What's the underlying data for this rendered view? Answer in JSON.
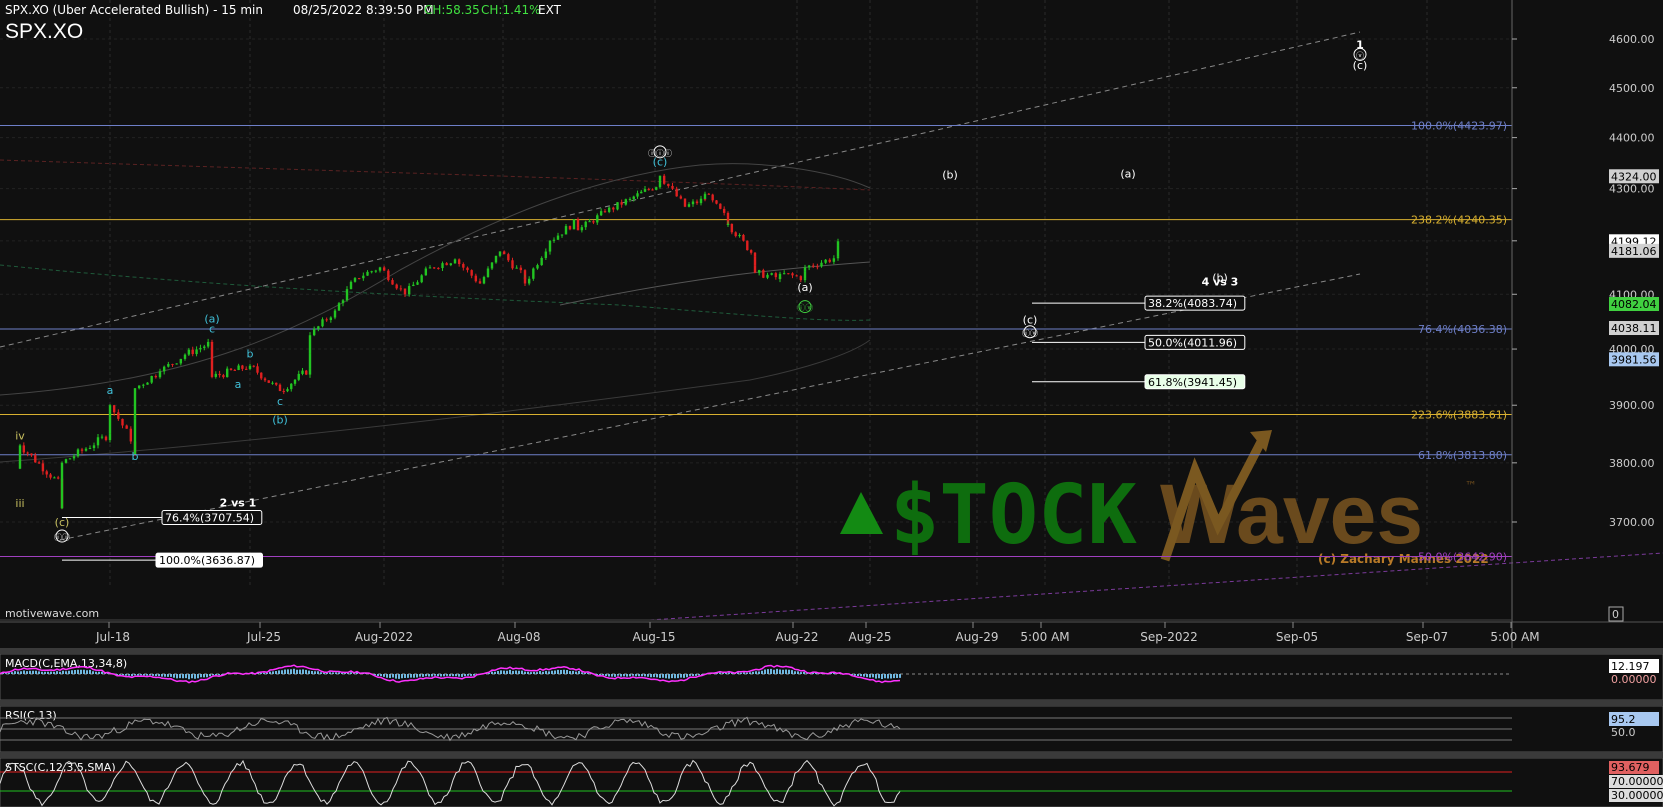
{
  "header": {
    "chart_title": "SPX.XO (Uber Accelerated Bullish) - 15 min",
    "datetime": "08/25/2022 8:39:50 PM",
    "ch_points": "CH:58.35",
    "ch_percent": "CH:1.41%",
    "session": "EXT",
    "symbol": "SPX.XO"
  },
  "credit": "motivewave.com",
  "watermark": {
    "brand_left": "$TOCK",
    "brand_right": "Waves",
    "tm": "™",
    "copyright": "(c) Zachary Mannes 2022"
  },
  "colors": {
    "background": "#101010",
    "candle_up": "#22c422",
    "candle_down": "#e02020",
    "fib_blue": "#6e7fc8",
    "fib_gold": "#d8b030",
    "wave_cyan": "#40c0d8",
    "wave_green": "#40d040",
    "wave_olive": "#c8c060",
    "macd_line": "#ff30ff",
    "macd_hist": "#70b8e0"
  },
  "chart_data": {
    "type": "candlestick",
    "title": "SPX.XO (Uber Accelerated Bullish) - 15 min",
    "timeframe": "15 min",
    "x_tick_labels": [
      "Jul-18",
      "Jul-25",
      "Aug-2022",
      "Aug-08",
      "Aug-15",
      "Aug-22",
      "Aug-25",
      "Aug-29",
      "5:00 AM",
      "Sep-2022",
      "Sep-05",
      "Sep-07",
      "5:00 AM"
    ],
    "y_tick_labels": [
      "4600.00",
      "4500.00",
      "4400.00",
      "4300.00",
      "4200.00",
      "4100.00",
      "4000.00",
      "3900.00",
      "3800.00",
      "3700.00"
    ],
    "ylim": [
      3600,
      4640
    ],
    "y_scale": "log",
    "price_path": [
      {
        "date": "Jul-14",
        "close": 3790
      },
      {
        "date": "Jul-14",
        "close": 3830
      },
      {
        "date": "Jul-15",
        "close": 3760
      },
      {
        "date": "Jul-15",
        "close": 3723
      },
      {
        "date": "Jul-15",
        "close": 3800
      },
      {
        "date": "Jul-18",
        "close": 3850
      },
      {
        "date": "Jul-18",
        "close": 3900
      },
      {
        "date": "Jul-19",
        "close": 3830
      },
      {
        "date": "Jul-19",
        "close": 3815
      },
      {
        "date": "Jul-19",
        "close": 3930
      },
      {
        "date": "Jul-20",
        "close": 3960
      },
      {
        "date": "Jul-21",
        "close": 3990
      },
      {
        "date": "Jul-22",
        "close": 4012
      },
      {
        "date": "Jul-22",
        "close": 3950
      },
      {
        "date": "Jul-25",
        "close": 3970
      },
      {
        "date": "Jul-26",
        "close": 3925
      },
      {
        "date": "Jul-27",
        "close": 3965
      },
      {
        "date": "Jul-27",
        "close": 4025
      },
      {
        "date": "Jul-28",
        "close": 4070
      },
      {
        "date": "Jul-29",
        "close": 4130
      },
      {
        "date": "Aug-01",
        "close": 4150
      },
      {
        "date": "Aug-02",
        "close": 4100
      },
      {
        "date": "Aug-03",
        "close": 4150
      },
      {
        "date": "Aug-04",
        "close": 4165
      },
      {
        "date": "Aug-05",
        "close": 4120
      },
      {
        "date": "Aug-08",
        "close": 4180
      },
      {
        "date": "Aug-09",
        "close": 4130
      },
      {
        "date": "Aug-09",
        "close": 4120
      },
      {
        "date": "Aug-10",
        "close": 4200
      },
      {
        "date": "Aug-11",
        "close": 4240
      },
      {
        "date": "Aug-11",
        "close": 4220
      },
      {
        "date": "Aug-12",
        "close": 4255
      },
      {
        "date": "Aug-15",
        "close": 4280
      },
      {
        "date": "Aug-16",
        "close": 4310
      },
      {
        "date": "Aug-16",
        "close": 4325
      },
      {
        "date": "Aug-17",
        "close": 4265
      },
      {
        "date": "Aug-18",
        "close": 4280
      },
      {
        "date": "Aug-18",
        "close": 4290
      },
      {
        "date": "Aug-19",
        "close": 4240
      },
      {
        "date": "Aug-19",
        "close": 4232
      },
      {
        "date": "Aug-22",
        "close": 4170
      },
      {
        "date": "Aug-22",
        "close": 4140
      },
      {
        "date": "Aug-23",
        "close": 4130
      },
      {
        "date": "Aug-23",
        "close": 4138
      },
      {
        "date": "Aug-24",
        "close": 4130
      },
      {
        "date": "Aug-24",
        "close": 4150
      },
      {
        "date": "Aug-25",
        "close": 4170
      },
      {
        "date": "Aug-25",
        "close": 4199.12
      }
    ],
    "fib_levels": [
      {
        "label": "100.0%(4423.97)",
        "value": 4423.97,
        "color": "#6e7fc8"
      },
      {
        "label": "238.2%(4240.35)",
        "value": 4240.35,
        "color": "#d8b030"
      },
      {
        "label": "76.4%(4036.38)",
        "value": 4036.38,
        "color": "#6e7fc8"
      },
      {
        "label": "223.6%(3883.61)",
        "value": 3883.61,
        "color": "#d8b030"
      },
      {
        "label": "61.8%(3813.80)",
        "value": 3813.8,
        "color": "#6e7fc8"
      },
      {
        "label": "50.0%(3642.90)",
        "value": 3642.9,
        "color": "#a040c0"
      }
    ],
    "support_boxes": [
      {
        "label": "38.2%(4083.74)",
        "value": 4083.74,
        "fill": "#101010",
        "text": "#ffffff"
      },
      {
        "label": "50.0%(4011.96)",
        "value": 4011.96,
        "fill": "#101010",
        "text": "#ffffff"
      },
      {
        "label": "61.8%(3941.45)",
        "value": 3941.45,
        "fill": "#e8ffe8",
        "text": "#000000"
      },
      {
        "label": "76.4%(3707.54)",
        "value": 3707.54,
        "fill": "#101010",
        "text": "#ffffff"
      },
      {
        "label": "100.0%(3636.87)",
        "value": 3636.87,
        "fill": "#ffffff",
        "text": "#000000"
      }
    ],
    "price_tags": [
      {
        "label": "4324.00",
        "value": 4324.0,
        "fill": "#d0d0d0"
      },
      {
        "label": "4199.12",
        "value": 4199.12,
        "fill": "#ffffff"
      },
      {
        "label": "4181.06",
        "value": 4181.06,
        "fill": "#d0d0d0"
      },
      {
        "label": "4082.04",
        "value": 4082.04,
        "fill": "#40d040"
      },
      {
        "label": "4038.11",
        "value": 4038.11,
        "fill": "#d0d0d0"
      },
      {
        "label": "3981.56",
        "value": 3981.56,
        "fill": "#a8c8f0"
      }
    ],
    "wave_labels": [
      {
        "text": "(a)",
        "date": "Jul-22",
        "price": 4048,
        "color": "#40c0d8"
      },
      {
        "text": "c",
        "date": "Jul-22",
        "price": 4030,
        "color": "#40c0d8"
      },
      {
        "text": "b",
        "date": "Jul-25",
        "price": 3985,
        "color": "#40c0d8"
      },
      {
        "text": "a",
        "date": "Jul-18",
        "price": 3920,
        "color": "#40c0d8"
      },
      {
        "text": "a",
        "date": "Jul-24",
        "price": 3930,
        "color": "#40c0d8"
      },
      {
        "text": "c",
        "date": "Jul-26",
        "price": 3900,
        "color": "#40c0d8"
      },
      {
        "text": "(b)",
        "date": "Jul-26",
        "price": 3868,
        "color": "#40c0d8"
      },
      {
        "text": "b",
        "date": "Jul-19",
        "price": 3805,
        "color": "#40c0d8"
      },
      {
        "text": "iv",
        "date": "Jul-14",
        "price": 3840,
        "color": "#c8c060"
      },
      {
        "text": "iii",
        "date": "Jul-14",
        "price": 3725,
        "color": "#c8c060"
      },
      {
        "text": "(c)",
        "date": "Jul-15",
        "price": 3693,
        "color": "#c8c060"
      },
      {
        "text": "ⓘⓘ",
        "date": "Jul-15",
        "price": 3670,
        "color": "#ffffff"
      },
      {
        "text": "2 vs 1",
        "date": "Jul-24",
        "price": 3726,
        "color": "#ffffff"
      },
      {
        "text": "ⓘⓘⓘ",
        "date": "Aug-16",
        "price": 4364,
        "color": "#ffffff"
      },
      {
        "text": "(c)",
        "date": "Aug-16",
        "price": 4345,
        "color": "#40c0d8"
      },
      {
        "text": "(a)",
        "date": "Aug-24",
        "price": 4106,
        "color": "#ffffff"
      },
      {
        "text": "ⓘⓥ",
        "date": "Aug-24",
        "price": 4070,
        "color": "#40d040"
      },
      {
        "text": "(b)",
        "date": "Aug-29",
        "price": 4320,
        "color": "#ffffff"
      },
      {
        "text": "(a)",
        "date": "Sep-01",
        "price": 4322,
        "color": "#ffffff"
      },
      {
        "text": "(b)",
        "date": "Sep-04",
        "price": 4124,
        "color": "#ffffff"
      },
      {
        "text": "4 vs 3",
        "date": "Sep-04",
        "price": 4116,
        "color": "#ffffff"
      },
      {
        "text": "(c)",
        "date": "Aug-31",
        "price": 4046,
        "color": "#ffffff"
      },
      {
        "text": "ⓘⓥ",
        "date": "Aug-31",
        "price": 4024,
        "color": "#ffffff"
      },
      {
        "text": "1",
        "date": "Sep-06",
        "price": 4580,
        "color": "#ffffff"
      },
      {
        "text": "ⓥ",
        "date": "Sep-06",
        "price": 4560,
        "color": "#ffffff"
      },
      {
        "text": "(c)",
        "date": "Sep-06",
        "price": 4538,
        "color": "#ffffff"
      }
    ],
    "indicators": [
      {
        "name": "MACD(C,EMA,13,34,8)",
        "value_tags": [
          "12.197",
          "0.00000"
        ]
      },
      {
        "name": "RSI(C,13)",
        "value_tags": [
          "95.2",
          "50.0"
        ]
      },
      {
        "name": "STSC(C,12,3,5,SMA)",
        "value_tags": [
          "93.679",
          "70.00000",
          "30.00000"
        ]
      }
    ],
    "legend": "none",
    "grid": true
  }
}
